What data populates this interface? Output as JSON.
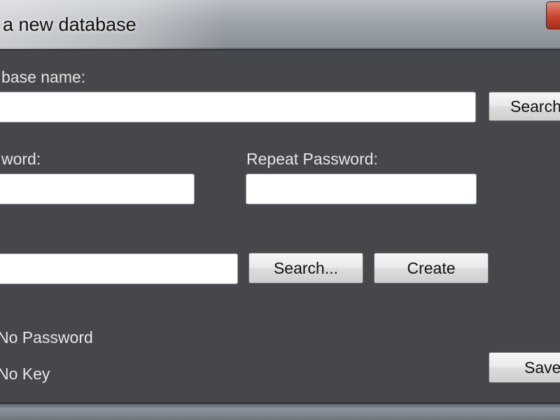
{
  "window": {
    "title": "a new database"
  },
  "form": {
    "database_name_label": "base name:",
    "database_name_value": "",
    "password_label": "word:",
    "password_value": "",
    "repeat_password_label": "Repeat Password:",
    "repeat_password_value": "",
    "key_file_value": "",
    "no_password_text": "No Password",
    "no_key_text": "No Key"
  },
  "buttons": {
    "search_top_label": "Search",
    "search_key_label": "Search...",
    "create_label": "Create",
    "save_label": "Save"
  }
}
